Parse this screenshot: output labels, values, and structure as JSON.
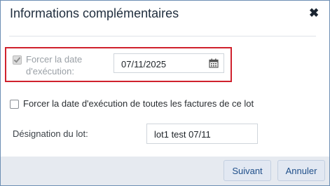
{
  "dialog": {
    "title": "Informations complémentaires",
    "close_icon": "close-icon"
  },
  "force_date": {
    "label_line1": "Forcer la date",
    "label_line2": "d'exécution:",
    "checked": true,
    "disabled": true,
    "date_value": "07/11/2025",
    "calendar_icon": "calendar-icon"
  },
  "force_all": {
    "label": "Forcer la date d'exécution de toutes les factures de ce lot",
    "checked": false
  },
  "designation": {
    "label": "Désignation du lot:",
    "value": "lot1 test 07/11"
  },
  "footer": {
    "next_label": "Suivant",
    "cancel_label": "Annuler"
  }
}
